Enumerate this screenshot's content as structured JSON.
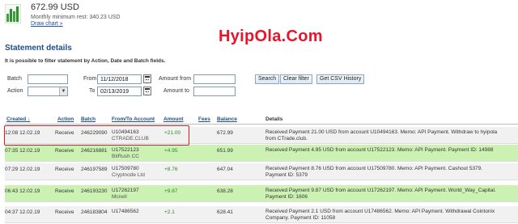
{
  "account": {
    "balance": "672.99 USD",
    "min_rest": "Monthly minimum rest: 340.23 USD",
    "draw_chart": "Draw chart »"
  },
  "watermark": "HyipOla.Com",
  "section_title": "Statement details",
  "filter_note": "It is possible to filter statement by Action, Date and Batch fields.",
  "filters": {
    "batch_label": "Batch",
    "action_label": "Action",
    "from_label": "From",
    "to_label": "To",
    "from_date": "11/12/2018",
    "to_date": "02/13/2019",
    "amount_from_label": "Amount from",
    "amount_to_label": "Amount to",
    "search_btn": "Search",
    "clear_btn": "Clear filter",
    "csv_btn": "Get CSV History"
  },
  "columns": {
    "created": "Created ↓",
    "action": "Action",
    "batch": "Batch",
    "from_to": "From/To Account",
    "amount": "Amount",
    "fees": "Fees",
    "balance": "Balance",
    "details": "Details"
  },
  "rows": [
    {
      "created": "12:08 12.02.19",
      "action": "Receive",
      "batch": "246229090",
      "account": "U10494163",
      "account_name": "CTRADE.CLUB",
      "amount": "+21.00",
      "balance": "672.99",
      "details1": "Received Payment 21.00 USD from account U10494163. Memo: API Payment. Withdraw to hyipola",
      "details2": "from CTrade.club."
    },
    {
      "created": "07:35 12.02.19",
      "action": "Receive",
      "batch": "246216881",
      "account": "U17522123",
      "account_name": "BitRush CC",
      "amount": "+4.95",
      "balance": "651.99",
      "details1": "Received Payment 4.95 USD from account U17522123. Memo: API Payment. Payment ID: 14988",
      "details2": ""
    },
    {
      "created": "07:29 12.02.19",
      "action": "Receive",
      "batch": "246197589",
      "account": "U17509780",
      "account_name": "Cryptnode Ltd",
      "amount": "+8.76",
      "balance": "647.04",
      "details1": "Received Payment 8.76 USD from account U17509780. Memo: API Payment. Cashout 5379.",
      "details2": "Payment ID: 5379"
    },
    {
      "created": "06:43 12.02.19",
      "action": "Receive",
      "batch": "246193230",
      "account": "U17262197",
      "account_name": "Mcnell",
      "amount": "+9.87",
      "balance": "638.28",
      "details1": "Received Payment 9.87 USD from account U17262197. Memo: API Payment. World_Way_Capital.",
      "details2": "Payment ID: 1606"
    },
    {
      "created": "04:37 12.02.19",
      "action": "Receive",
      "batch": "246183804",
      "account": "U17486562",
      "account_name": "",
      "amount": "+2.1",
      "balance": "628.41",
      "details1": "Received Payment 2.1 USD from account U17486562. Memo: API Payment. Withdrawal Cointonix",
      "details2": "Company. Payment ID: 11058"
    }
  ],
  "colors": {
    "title_blue": "#1e4f8c",
    "highlight_row": "#ccf2b3",
    "amount_green": "#2b8a1f",
    "watermark_red": "#e8142a"
  }
}
